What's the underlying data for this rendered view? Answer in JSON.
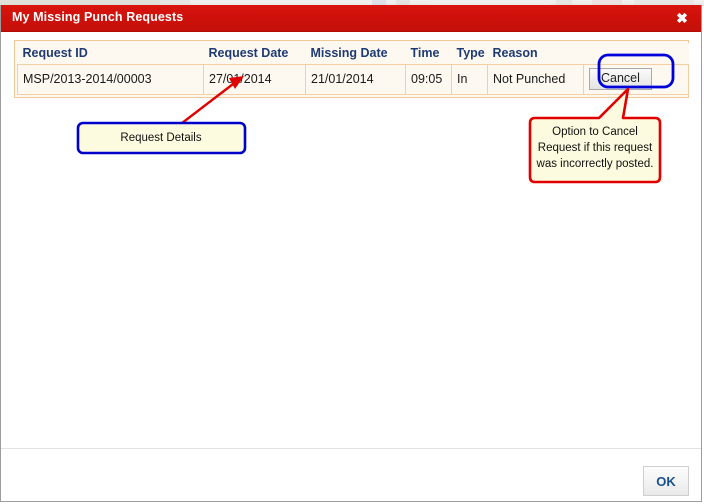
{
  "window": {
    "title": "My Missing Punch Requests",
    "close_icon": "close-icon",
    "close_glyph": "✖"
  },
  "grid": {
    "columns": [
      "Request ID",
      "Request Date",
      "Missing Date",
      "Time",
      "Type",
      "Reason",
      ""
    ],
    "rows": [
      {
        "request_id": "MSP/2013-2014/00003",
        "request_date": "27/01/2014",
        "missing_date": "21/01/2014",
        "time": "09:05",
        "type": "In",
        "reason": "Not Punched",
        "action_label": "Cancel"
      }
    ]
  },
  "annotations": {
    "request_details": {
      "text": "Request Details",
      "border_color": "#0000cc",
      "fill_color": "#fdfbdf"
    },
    "cancel_callout": {
      "line1": "Option to Cancel",
      "line2": "Request if this request",
      "line3": "was incorrectly posted.",
      "border_color": "#e00000",
      "fill_color": "#fdfbdf"
    },
    "arrow_color": "#e00000",
    "highlight_color": "#0000dd"
  },
  "footer": {
    "ok_label": "OK"
  },
  "colors": {
    "titlebar": "#cf110b",
    "grid_border": "#f0c898",
    "grid_bg": "#fdf9f0",
    "header_text": "#1f3b73",
    "ok_text": "#17508f"
  }
}
